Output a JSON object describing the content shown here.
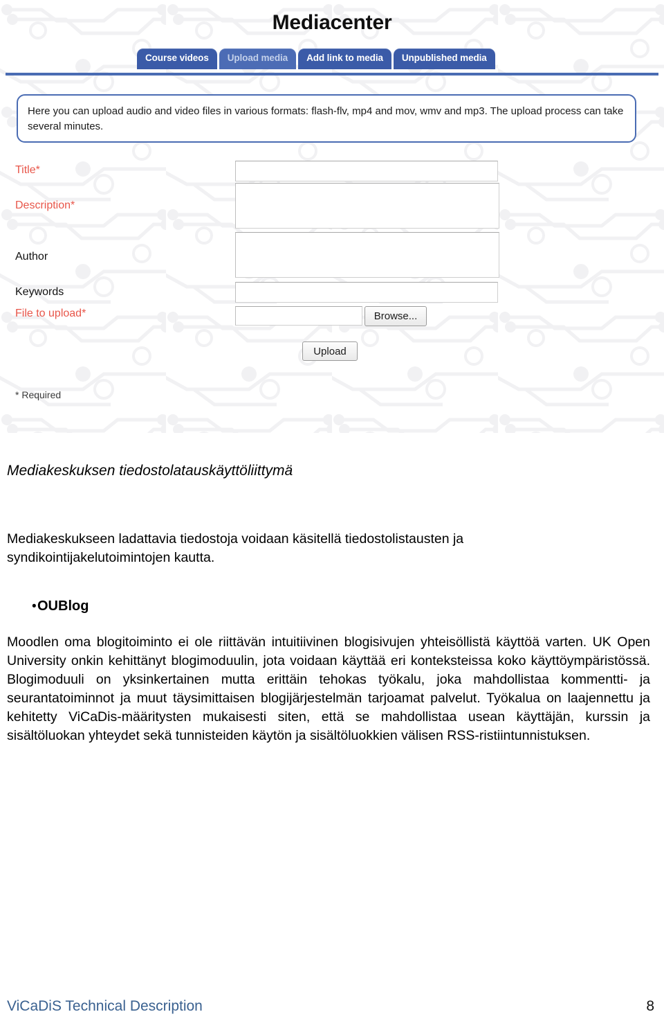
{
  "figure": {
    "app_title": "Mediacenter",
    "tabs": [
      {
        "label": "Course videos",
        "selected": false
      },
      {
        "label": "Upload media",
        "selected": true
      },
      {
        "label": "Add link to media",
        "selected": false
      },
      {
        "label": "Unpublished media",
        "selected": false
      }
    ],
    "info_text": "Here you can upload audio and video files in various formats: flash-flv, mp4 and mov, wmv and mp3. The upload process can take several minutes.",
    "form": {
      "fields": [
        {
          "label": "Title*",
          "required": true
        },
        {
          "label": "Description*",
          "required": true
        },
        {
          "label": "Author",
          "required": false
        },
        {
          "label": "Keywords",
          "required": false
        },
        {
          "label": "File to upload*",
          "required": true
        }
      ],
      "browse_label": "Browse...",
      "upload_label": "Upload",
      "required_note": "* Required"
    },
    "colors": {
      "tab_bg": "#3b5ba8",
      "tab_selected_bg": "#4c6cb5",
      "tab_selected_text": "#c3d0ea",
      "rule": "#4a6cb3",
      "infobox_border": "#4a6cb3",
      "required_label": "#e8564a"
    }
  },
  "document": {
    "section_heading": "Mediakeskuksen tiedostolatauskäyttöliittymä",
    "intro_paragraph": "Mediakeskukseen ladattavia tiedostoja voidaan käsitellä tiedostolistausten ja syndikointijakelutoimintojen kautta.",
    "bullet": {
      "marker": "•",
      "label": "OUBlog"
    },
    "body_paragraph": "Moodlen oma blogitoiminto ei ole riittävän intuitiivinen blogisivujen yhteisöllistä käyttöä varten. UK Open University onkin kehittänyt blogimoduulin, jota voidaan käyttää eri konteksteissa koko käyttöympäristössä. Blogimoduuli on yksinkertainen mutta erittäin tehokas työkalu, joka mahdollistaa kommentti- ja seurantatoiminnot ja muut täysimittaisen blogijärjestelmän tarjoamat palvelut. Työkalua on laajennettu ja kehitetty ViCaDis-määritysten mukaisesti siten, että se mahdollistaa usean käyttäjän, kurssin ja sisältöluokan yhteydet sekä tunnisteiden käytön ja sisältöluokkien välisen RSS-ristiintunnistuksen."
  },
  "footer": {
    "title": "ViCaDiS Technical Description",
    "page_number": "8",
    "title_color": "#3a6190"
  }
}
